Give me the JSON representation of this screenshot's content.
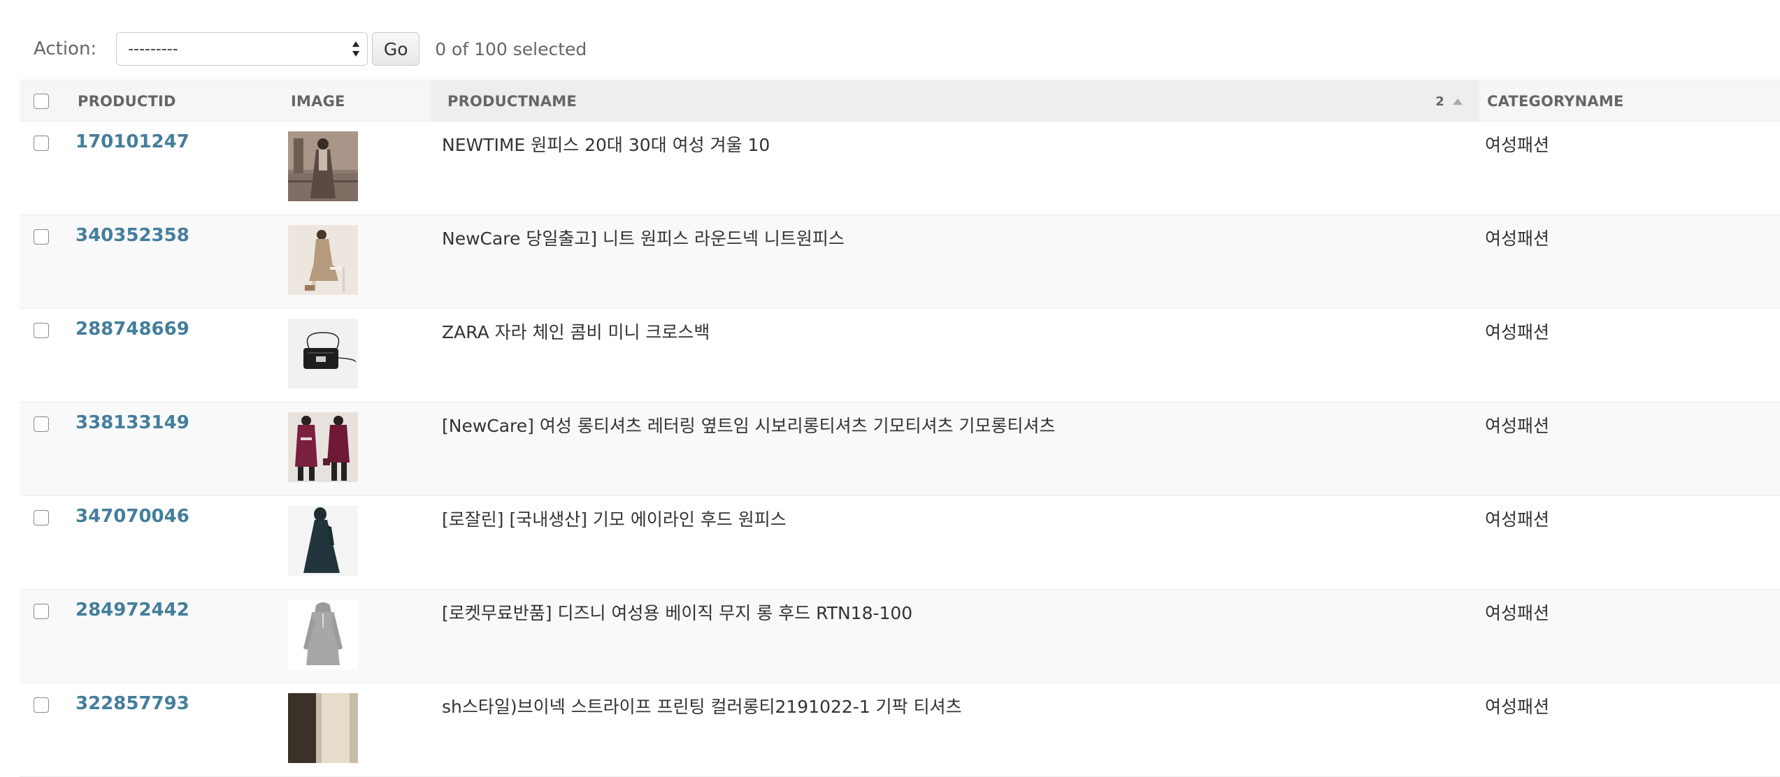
{
  "actions": {
    "label": "Action:",
    "select_value": "---------",
    "go_label": "Go",
    "selected_text": "0 of 100 selected"
  },
  "table": {
    "headers": {
      "product_id": "PRODUCTID",
      "image": "IMAGE",
      "product_name": "PRODUCTNAME",
      "category_name": "CATEGORYNAME"
    },
    "sort": {
      "priority": "2",
      "direction": "ascending"
    },
    "rows": [
      {
        "id": "170101247",
        "name": "NEWTIME 원피스 20대 30대 여성 겨울 10",
        "category": "여성패션",
        "thumb": "woman-coat-street"
      },
      {
        "id": "340352358",
        "name": "NewCare 당일출고] 니트 원피스 라운드넥 니트원피스",
        "category": "여성패션",
        "thumb": "woman-beige-knit-seated"
      },
      {
        "id": "288748669",
        "name": "ZARA 자라 체인 콤비 미니 크로스백",
        "category": "여성패션",
        "thumb": "black-crossbody-bag"
      },
      {
        "id": "338133149",
        "name": "[NewCare] 여성 롱티셔츠 레터링 옆트임 시보리롱티셔츠 기모티셔츠 기모롱티셔츠",
        "category": "여성패션",
        "thumb": "burgundy-long-tee"
      },
      {
        "id": "347070046",
        "name": "[로잘린] [국내생산] 기모 에이라인 후드 원피스",
        "category": "여성패션",
        "thumb": "dark-hood-dress"
      },
      {
        "id": "284972442",
        "name": "[로켓무료반품] 디즈니 여성용 베이직 무지 롱 후드 RTN18-100",
        "category": "여성패션",
        "thumb": "grey-long-hoodie"
      },
      {
        "id": "322857793",
        "name": "sh스타일)브이넥 스트라이프 프린팅 컬러롱티2191022-1 기팍 티셔츠",
        "category": "여성패션",
        "thumb": "stripe-tee"
      }
    ]
  },
  "colors": {
    "link": "#447e9b",
    "header_bg": "#f6f6f6",
    "sorted_header_bg": "#eeeeee",
    "alt_row_bg": "#f9f9f9"
  }
}
